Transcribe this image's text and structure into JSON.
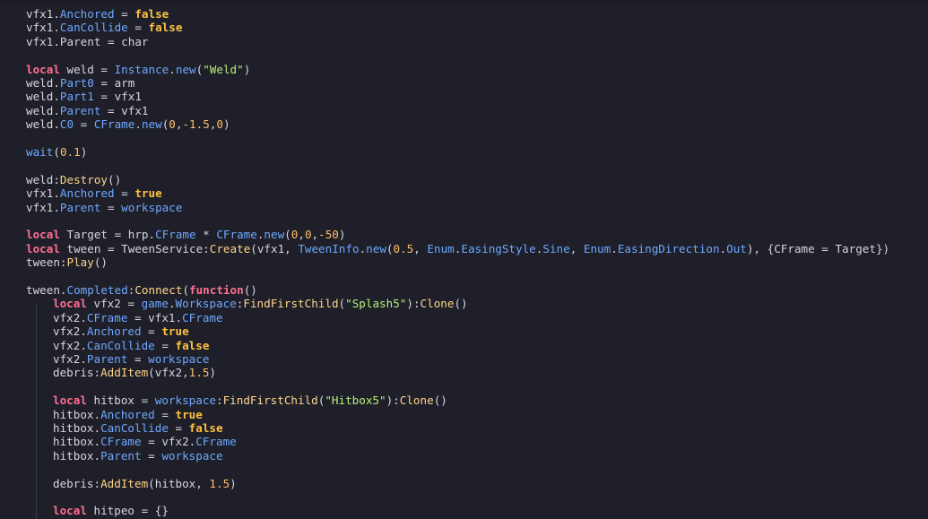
{
  "colors": {
    "background": "#1e1f29",
    "keyword": "#ff6f91",
    "boolean": "#ffc140",
    "property": "#6fa8ff",
    "number": "#ffbf6b",
    "string": "#b6f07a",
    "function": "#ffd58a",
    "text": "#d6d6e0"
  },
  "editor": {
    "lines": [
      {
        "indent": 0,
        "tokens": [
          [
            "plain",
            "vfx1."
          ],
          [
            "prop",
            "Anchored"
          ],
          [
            "plain",
            " = "
          ],
          [
            "bool",
            "false"
          ]
        ]
      },
      {
        "indent": 0,
        "tokens": [
          [
            "plain",
            "vfx1."
          ],
          [
            "prop",
            "CanCollide"
          ],
          [
            "plain",
            " = "
          ],
          [
            "bool",
            "false"
          ]
        ]
      },
      {
        "indent": 0,
        "tokens": [
          [
            "plain",
            "vfx1.Parent = char"
          ]
        ]
      },
      {
        "indent": 0,
        "tokens": []
      },
      {
        "indent": 0,
        "tokens": [
          [
            "kw",
            "local"
          ],
          [
            "plain",
            " weld = "
          ],
          [
            "prop",
            "Instance"
          ],
          [
            "plain",
            "."
          ],
          [
            "prop",
            "new"
          ],
          [
            "plain",
            "("
          ],
          [
            "str",
            "\"Weld\""
          ],
          [
            "plain",
            ")"
          ]
        ]
      },
      {
        "indent": 0,
        "tokens": [
          [
            "plain",
            "weld."
          ],
          [
            "prop",
            "Part0"
          ],
          [
            "plain",
            " = arm"
          ]
        ]
      },
      {
        "indent": 0,
        "tokens": [
          [
            "plain",
            "weld."
          ],
          [
            "prop",
            "Part1"
          ],
          [
            "plain",
            " = vfx1"
          ]
        ]
      },
      {
        "indent": 0,
        "tokens": [
          [
            "plain",
            "weld."
          ],
          [
            "prop",
            "Parent"
          ],
          [
            "plain",
            " = vfx1"
          ]
        ]
      },
      {
        "indent": 0,
        "tokens": [
          [
            "plain",
            "weld."
          ],
          [
            "prop",
            "C0"
          ],
          [
            "plain",
            " = "
          ],
          [
            "prop",
            "CFrame"
          ],
          [
            "plain",
            "."
          ],
          [
            "prop",
            "new"
          ],
          [
            "plain",
            "("
          ],
          [
            "num",
            "0"
          ],
          [
            "plain",
            ","
          ],
          [
            "num",
            "-1.5"
          ],
          [
            "plain",
            ","
          ],
          [
            "num",
            "0"
          ],
          [
            "plain",
            ")"
          ]
        ]
      },
      {
        "indent": 0,
        "tokens": []
      },
      {
        "indent": 0,
        "tokens": [
          [
            "prop",
            "wait"
          ],
          [
            "plain",
            "("
          ],
          [
            "num",
            "0.1"
          ],
          [
            "plain",
            ")"
          ]
        ]
      },
      {
        "indent": 0,
        "tokens": []
      },
      {
        "indent": 0,
        "tokens": [
          [
            "plain",
            "weld:"
          ],
          [
            "fn",
            "Destroy"
          ],
          [
            "plain",
            "()"
          ]
        ]
      },
      {
        "indent": 0,
        "tokens": [
          [
            "plain",
            "vfx1."
          ],
          [
            "prop",
            "Anchored"
          ],
          [
            "plain",
            " = "
          ],
          [
            "bool",
            "true"
          ]
        ]
      },
      {
        "indent": 0,
        "tokens": [
          [
            "plain",
            "vfx1."
          ],
          [
            "prop",
            "Parent"
          ],
          [
            "plain",
            " = "
          ],
          [
            "prop",
            "workspace"
          ]
        ]
      },
      {
        "indent": 0,
        "tokens": []
      },
      {
        "indent": 0,
        "tokens": [
          [
            "kw",
            "local"
          ],
          [
            "plain",
            " Target = hrp."
          ],
          [
            "prop",
            "CFrame"
          ],
          [
            "plain",
            " * "
          ],
          [
            "prop",
            "CFrame"
          ],
          [
            "plain",
            "."
          ],
          [
            "prop",
            "new"
          ],
          [
            "plain",
            "("
          ],
          [
            "num",
            "0"
          ],
          [
            "plain",
            ","
          ],
          [
            "num",
            "0"
          ],
          [
            "plain",
            ","
          ],
          [
            "num",
            "-50"
          ],
          [
            "plain",
            ")"
          ]
        ]
      },
      {
        "indent": 0,
        "tokens": [
          [
            "kw",
            "local"
          ],
          [
            "plain",
            " tween = TweenService:"
          ],
          [
            "fn",
            "Create"
          ],
          [
            "plain",
            "(vfx1, "
          ],
          [
            "prop",
            "TweenInfo"
          ],
          [
            "plain",
            "."
          ],
          [
            "prop",
            "new"
          ],
          [
            "plain",
            "("
          ],
          [
            "num",
            "0.5"
          ],
          [
            "plain",
            ", "
          ],
          [
            "prop",
            "Enum"
          ],
          [
            "plain",
            "."
          ],
          [
            "prop",
            "EasingStyle"
          ],
          [
            "plain",
            "."
          ],
          [
            "prop",
            "Sine"
          ],
          [
            "plain",
            ", "
          ],
          [
            "prop",
            "Enum"
          ],
          [
            "plain",
            "."
          ],
          [
            "prop",
            "EasingDirection"
          ],
          [
            "plain",
            "."
          ],
          [
            "prop",
            "Out"
          ],
          [
            "plain",
            "), {CFrame = Target})"
          ]
        ]
      },
      {
        "indent": 0,
        "tokens": [
          [
            "plain",
            "tween:"
          ],
          [
            "fn",
            "Play"
          ],
          [
            "plain",
            "()"
          ]
        ]
      },
      {
        "indent": 0,
        "tokens": []
      },
      {
        "indent": 0,
        "tokens": [
          [
            "plain",
            "tween."
          ],
          [
            "prop",
            "Completed"
          ],
          [
            "plain",
            ":"
          ],
          [
            "fn",
            "Connect"
          ],
          [
            "plain",
            "("
          ],
          [
            "kw",
            "function"
          ],
          [
            "plain",
            "()"
          ]
        ]
      },
      {
        "indent": 1,
        "tokens": [
          [
            "kw",
            "local"
          ],
          [
            "plain",
            " vfx2 = "
          ],
          [
            "prop",
            "game"
          ],
          [
            "plain",
            "."
          ],
          [
            "prop",
            "Workspace"
          ],
          [
            "plain",
            ":"
          ],
          [
            "fn",
            "FindFirstChild"
          ],
          [
            "plain",
            "("
          ],
          [
            "str",
            "\"Splash5\""
          ],
          [
            "plain",
            "):"
          ],
          [
            "fn",
            "Clone"
          ],
          [
            "plain",
            "()"
          ]
        ]
      },
      {
        "indent": 1,
        "tokens": [
          [
            "plain",
            "vfx2."
          ],
          [
            "prop",
            "CFrame"
          ],
          [
            "plain",
            " = vfx1."
          ],
          [
            "prop",
            "CFrame"
          ]
        ]
      },
      {
        "indent": 1,
        "tokens": [
          [
            "plain",
            "vfx2."
          ],
          [
            "prop",
            "Anchored"
          ],
          [
            "plain",
            " = "
          ],
          [
            "bool",
            "true"
          ]
        ]
      },
      {
        "indent": 1,
        "tokens": [
          [
            "plain",
            "vfx2."
          ],
          [
            "prop",
            "CanCollide"
          ],
          [
            "plain",
            " = "
          ],
          [
            "bool",
            "false"
          ]
        ]
      },
      {
        "indent": 1,
        "tokens": [
          [
            "plain",
            "vfx2."
          ],
          [
            "prop",
            "Parent"
          ],
          [
            "plain",
            " = "
          ],
          [
            "prop",
            "workspace"
          ]
        ]
      },
      {
        "indent": 1,
        "tokens": [
          [
            "plain",
            "debris:"
          ],
          [
            "fn",
            "AddItem"
          ],
          [
            "plain",
            "(vfx2,"
          ],
          [
            "num",
            "1.5"
          ],
          [
            "plain",
            ")"
          ]
        ]
      },
      {
        "indent": 1,
        "tokens": []
      },
      {
        "indent": 1,
        "tokens": [
          [
            "kw",
            "local"
          ],
          [
            "plain",
            " hitbox = "
          ],
          [
            "prop",
            "workspace"
          ],
          [
            "plain",
            ":"
          ],
          [
            "fn",
            "FindFirstChild"
          ],
          [
            "plain",
            "("
          ],
          [
            "str",
            "\"Hitbox5\""
          ],
          [
            "plain",
            "):"
          ],
          [
            "fn",
            "Clone"
          ],
          [
            "plain",
            "()"
          ]
        ]
      },
      {
        "indent": 1,
        "tokens": [
          [
            "plain",
            "hitbox."
          ],
          [
            "prop",
            "Anchored"
          ],
          [
            "plain",
            " = "
          ],
          [
            "bool",
            "true"
          ]
        ]
      },
      {
        "indent": 1,
        "tokens": [
          [
            "plain",
            "hitbox."
          ],
          [
            "prop",
            "CanCollide"
          ],
          [
            "plain",
            " = "
          ],
          [
            "bool",
            "false"
          ]
        ]
      },
      {
        "indent": 1,
        "tokens": [
          [
            "plain",
            "hitbox."
          ],
          [
            "prop",
            "CFrame"
          ],
          [
            "plain",
            " = vfx2."
          ],
          [
            "prop",
            "CFrame"
          ]
        ]
      },
      {
        "indent": 1,
        "tokens": [
          [
            "plain",
            "hitbox."
          ],
          [
            "prop",
            "Parent"
          ],
          [
            "plain",
            " = "
          ],
          [
            "prop",
            "workspace"
          ]
        ]
      },
      {
        "indent": 1,
        "tokens": []
      },
      {
        "indent": 1,
        "tokens": [
          [
            "plain",
            "debris:"
          ],
          [
            "fn",
            "AddItem"
          ],
          [
            "plain",
            "(hitbox, "
          ],
          [
            "num",
            "1.5"
          ],
          [
            "plain",
            ")"
          ]
        ]
      },
      {
        "indent": 1,
        "tokens": []
      },
      {
        "indent": 1,
        "tokens": [
          [
            "kw",
            "local"
          ],
          [
            "plain",
            " hitpeo = {}"
          ]
        ]
      }
    ]
  }
}
